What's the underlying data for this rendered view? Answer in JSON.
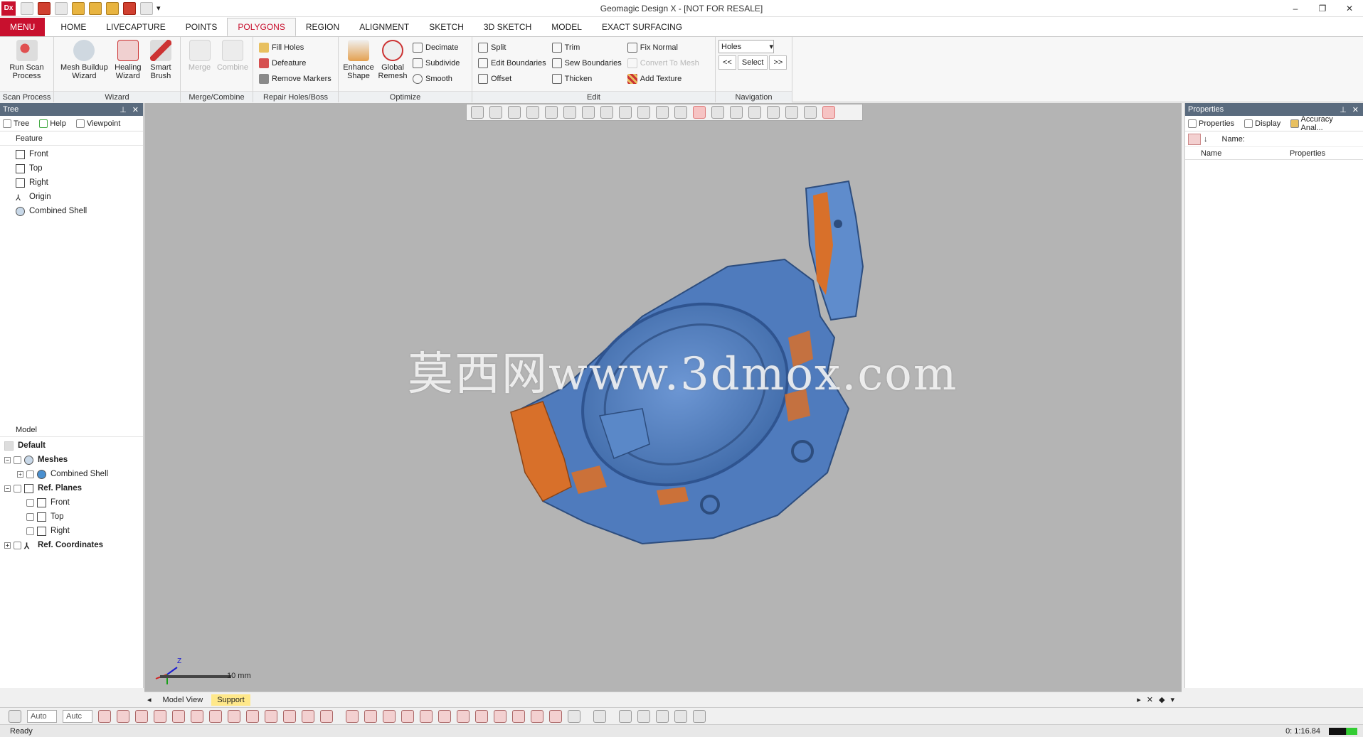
{
  "app": {
    "logo": "Dx",
    "title": "Geomagic Design X - [NOT FOR RESALE]"
  },
  "ribbon_tabs": {
    "menu": "MENU",
    "tabs": [
      "HOME",
      "LIVECAPTURE",
      "POINTS",
      "POLYGONS",
      "REGION",
      "ALIGNMENT",
      "SKETCH",
      "3D SKETCH",
      "MODEL",
      "EXACT SURFACING"
    ],
    "active": "POLYGONS"
  },
  "ribbon": {
    "scan_process": {
      "label": "Scan Process",
      "run_scan": "Run Scan Process"
    },
    "wizard": {
      "label": "Wizard",
      "mesh_buildup": "Mesh Buildup Wizard",
      "healing": "Healing Wizard",
      "smart_brush": "Smart Brush"
    },
    "merge": {
      "label": "Merge/Combine",
      "merge": "Merge",
      "combine": "Combine"
    },
    "repair": {
      "label": "Repair Holes/Boss",
      "fill_holes": "Fill Holes",
      "defeature": "Defeature",
      "remove_markers": "Remove Markers"
    },
    "optimize": {
      "label": "Optimize",
      "enhance_shape": "Enhance Shape",
      "global_remesh": "Global Remesh",
      "decimate": "Decimate",
      "subdivide": "Subdivide",
      "smooth": "Smooth"
    },
    "edit": {
      "label": "Edit",
      "split": "Split",
      "edit_boundaries": "Edit Boundaries",
      "offset": "Offset",
      "trim": "Trim",
      "sew_boundaries": "Sew Boundaries",
      "thicken": "Thicken",
      "fix_normal": "Fix Normal",
      "convert_to_mesh": "Convert To Mesh",
      "add_texture": "Add Texture"
    },
    "navigation": {
      "label": "Navigation",
      "combo_value": "Holes",
      "prev": "<<",
      "select": "Select",
      "next": ">>"
    }
  },
  "tree_panel": {
    "title": "Tree",
    "tabs": [
      "Tree",
      "Help",
      "Viewpoint"
    ],
    "feature_header": "Feature",
    "features": [
      "Front",
      "Top",
      "Right",
      "Origin",
      "Combined Shell"
    ],
    "model_header": "Model",
    "model": {
      "default": "Default",
      "meshes": "Meshes",
      "combined_shell": "Combined Shell",
      "ref_planes": "Ref. Planes",
      "front": "Front",
      "top": "Top",
      "right": "Right",
      "ref_coords": "Ref. Coordinates"
    }
  },
  "viewport": {
    "watermark": "莫西网www.3dmox.com",
    "scale_label": "10 mm",
    "axis_z": "Z",
    "view_tabs": [
      "Model View",
      "Support"
    ]
  },
  "properties_panel": {
    "title": "Properties",
    "tabs": [
      "Properties",
      "Display",
      "Accuracy Anal..."
    ],
    "name_label": "Name:",
    "col_name": "Name",
    "col_props": "Properties"
  },
  "bottom_toolbar": {
    "combo1": "Auto",
    "combo2": "Autc"
  },
  "status": {
    "text": "Ready",
    "time": "0: 1:16.84"
  },
  "colors": {
    "brand_red": "#c8102e",
    "mesh_blue": "#5b86c4",
    "mesh_orange": "#d8702a",
    "viewport_bg": "#b4b4b4"
  }
}
